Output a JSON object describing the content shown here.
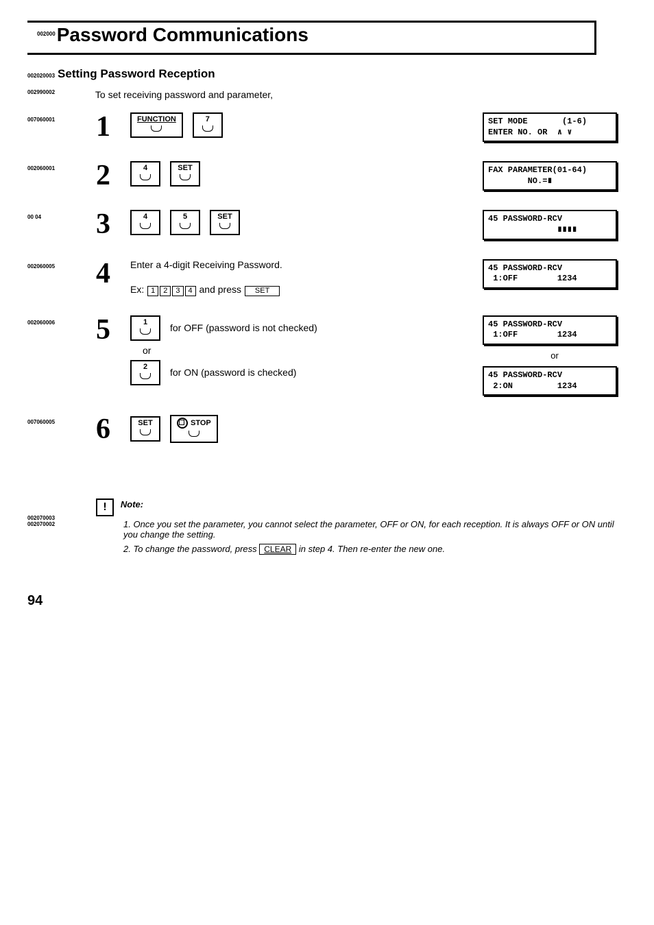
{
  "title": {
    "code": "002000",
    "text": "Password Communications"
  },
  "subheading": {
    "code": "002020003",
    "text": "Setting Password Reception"
  },
  "intro": {
    "code": "002990002",
    "text": "To set receiving password and parameter,"
  },
  "steps": {
    "s1": {
      "left_code": "007060001",
      "num": "1",
      "keys": {
        "function": "FUNCTION",
        "seven": "7"
      },
      "display": "SET MODE       (1-6)\nENTER NO. OR  ∧ ∨"
    },
    "s2": {
      "left_code": "002060001",
      "num": "2",
      "keys": {
        "four": "4",
        "set": "SET"
      },
      "display": "FAX PARAMETER(01-64)\n        NO.=∎"
    },
    "s3": {
      "left_code": "00    04",
      "num": "3",
      "keys": {
        "four": "4",
        "five": "5",
        "set": "SET"
      },
      "display": "45 PASSWORD-RCV\n              ∎∎∎∎"
    },
    "s4": {
      "left_code": "002060005",
      "num": "4",
      "line1": "Enter a 4-digit Receiving Password.",
      "ex_prefix": "Ex:",
      "ex_keys": {
        "k1": "1",
        "k2": "2",
        "k3": "3",
        "k4": "4"
      },
      "ex_mid": " and press ",
      "ex_set": "SET",
      "display": "45 PASSWORD-RCV\n 1:OFF        1234"
    },
    "s5": {
      "left_code": "002060006",
      "num": "5",
      "opt1_key": "1",
      "opt1_text": "for OFF (password is not checked)",
      "or": "or",
      "opt2_key": "2",
      "opt2_text": "for ON (password is checked)",
      "display1": "45 PASSWORD-RCV\n 1:OFF        1234",
      "display_or": "or",
      "display2": "45 PASSWORD-RCV\n 2:ON         1234"
    },
    "s6": {
      "left_code": "007060005",
      "num": "6",
      "keys": {
        "set": "SET",
        "stop": "STOP"
      }
    }
  },
  "note": {
    "left_codes": "002070003\n002070002",
    "label": "Note:",
    "n1_num": "1.",
    "n1": "Once you set the parameter, you cannot select the parameter, OFF or ON, for each reception. It is always OFF or ON until you change the setting.",
    "n2_num": "2.",
    "n2_a": "To change the password, press ",
    "n2_key": "CLEAR",
    "n2_b": " in step 4. Then re-enter the new one."
  },
  "page_number": "94"
}
